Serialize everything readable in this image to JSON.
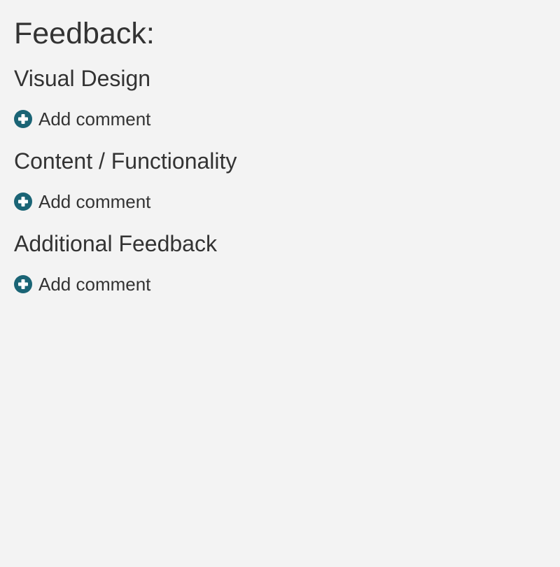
{
  "page": {
    "title": "Feedback:"
  },
  "colors": {
    "background": "#f3f3f3",
    "text": "#333333",
    "accent": "#1a6475"
  },
  "sections": [
    {
      "title": "Visual Design",
      "action": {
        "label": "Add comment",
        "icon": "plus-circle-icon"
      }
    },
    {
      "title": "Content / Functionality",
      "action": {
        "label": "Add comment",
        "icon": "plus-circle-icon"
      }
    },
    {
      "title": "Additional Feedback",
      "action": {
        "label": "Add comment",
        "icon": "plus-circle-icon"
      }
    }
  ]
}
